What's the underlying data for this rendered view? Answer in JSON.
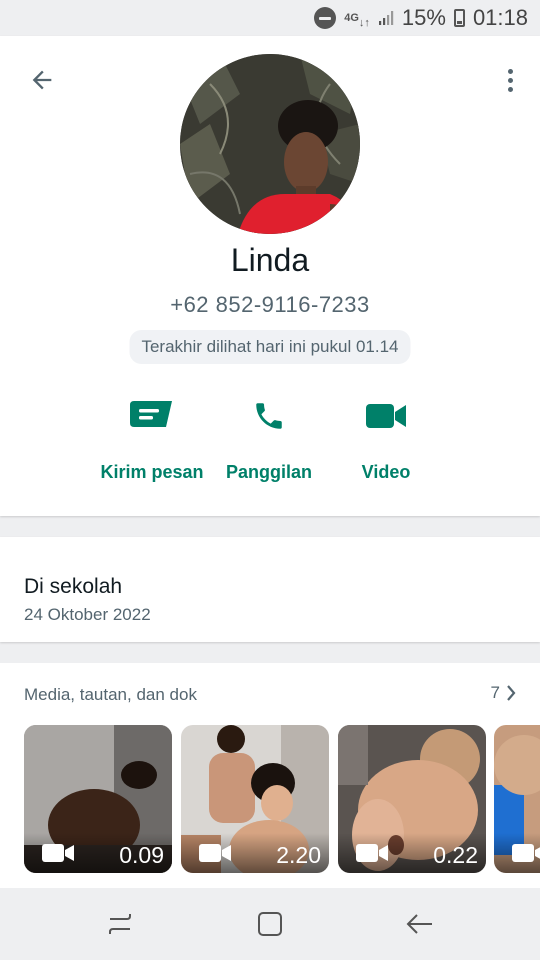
{
  "status_bar": {
    "network": "4G",
    "battery": "15%",
    "time": "01:18"
  },
  "header": {
    "back_icon": "arrow-left-icon",
    "menu_icon": "more-vert-icon"
  },
  "contact": {
    "name": "Linda",
    "phone": "+62 852-9116-7233",
    "last_seen": "Terakhir dilihat hari ini pukul 01.14"
  },
  "actions": [
    {
      "label": "Kirim pesan",
      "icon": "message-icon"
    },
    {
      "label": "Panggilan",
      "icon": "phone-icon"
    },
    {
      "label": "Video",
      "icon": "video-icon"
    }
  ],
  "about": {
    "text": "Di sekolah",
    "date": "24 Oktober 2022"
  },
  "media": {
    "title": "Media, tautan, dan dok",
    "count": "7",
    "items": [
      {
        "duration": "0.09"
      },
      {
        "duration": "2.20"
      },
      {
        "duration": "0.22"
      },
      {
        "duration": ""
      }
    ]
  },
  "colors": {
    "accent": "#008069",
    "text_primary": "#111b21",
    "text_secondary": "#54656f",
    "background": "#eeeff1"
  }
}
